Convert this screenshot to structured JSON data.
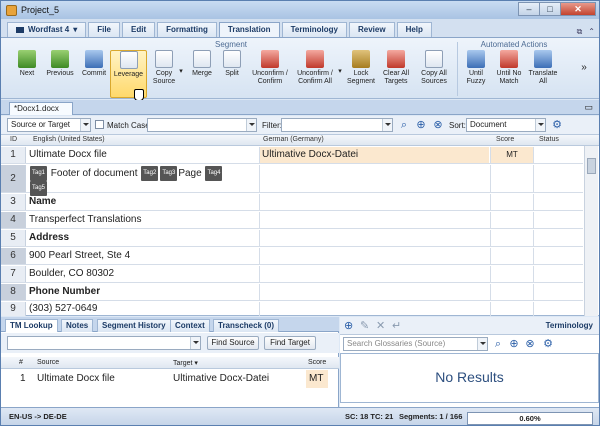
{
  "window": {
    "title": "Project_5",
    "min": "–",
    "max": "□",
    "close": "✕"
  },
  "menu": {
    "wordfast": "Wordfast 4",
    "file": "File",
    "edit": "Edit",
    "formatting": "Formatting",
    "translation": "Translation",
    "terminology": "Terminology",
    "review": "Review",
    "help": "Help"
  },
  "ribbon": {
    "segment_group": "Segment",
    "automated_group": "Automated Actions",
    "buttons": [
      {
        "label": "Next"
      },
      {
        "label": "Previous"
      },
      {
        "label": "Commit"
      },
      {
        "label": "Leverage"
      },
      {
        "label": "Copy Source"
      },
      {
        "label": "Merge"
      },
      {
        "label": "Split"
      },
      {
        "label": "Unconfirm / Confirm"
      },
      {
        "label": "Unconfirm / Confirm All"
      },
      {
        "label": "Lock Segment"
      },
      {
        "label": "Clear All Targets"
      },
      {
        "label": "Copy All Sources"
      },
      {
        "label": "Until Fuzzy"
      },
      {
        "label": "Until No Match"
      },
      {
        "label": "Translate All"
      }
    ],
    "more": "»"
  },
  "doc_tab": "*Docx1.docx",
  "filter": {
    "scope": "Source or Target",
    "match_case": "Match Case",
    "filter_label": "Filter:",
    "sort_label": "Sort:",
    "sort_value": "Document"
  },
  "grid": {
    "headers": {
      "id": "ID",
      "source": "English (United States)",
      "target": "German (Germany)",
      "score": "Score",
      "status": "Status"
    },
    "rows": [
      {
        "id": "1",
        "source": "Ultimate Docx file",
        "target": "Ultimative Docx-Datei",
        "score": "MT"
      },
      {
        "id": "2",
        "tag1": "Tag1",
        "source_a": "Footer of document",
        "tag2": "Tag2",
        "tag3": "Tag3",
        "source_b": "Page",
        "tag4": "Tag4",
        "tag5": "Tag5"
      },
      {
        "id": "3",
        "source": "Name"
      },
      {
        "id": "4",
        "source": "Transperfect Translations"
      },
      {
        "id": "5",
        "source": "Address"
      },
      {
        "id": "6",
        "source": "900 Pearl Street, Ste 4"
      },
      {
        "id": "7",
        "source": "Boulder, CO 80302"
      },
      {
        "id": "8",
        "source": "Phone Number"
      },
      {
        "id": "9",
        "source": "(303) 527-0649"
      }
    ]
  },
  "bottom_tabs": [
    "TM Lookup",
    "Notes",
    "Segment History",
    "Context",
    "Transcheck (0)"
  ],
  "tm": {
    "find_source": "Find Source",
    "find_target": "Find Target",
    "headers": {
      "num": "#",
      "source": "Source",
      "target": "Target",
      "score": "Score"
    },
    "row": {
      "num": "1",
      "source": "Ultimate Docx file",
      "target": "Ultimative Docx-Datei",
      "score": "MT"
    }
  },
  "terminology": {
    "title": "Terminology",
    "search_placeholder": "Search Glossaries (Source)",
    "no_results": "No Results"
  },
  "status": {
    "langs": "EN-US -> DE-DE",
    "counts": "SC: 18 TC: 21",
    "segments": "Segments: 1 / 166",
    "progress": "0.60%",
    "progress_fraction": 0.006
  }
}
